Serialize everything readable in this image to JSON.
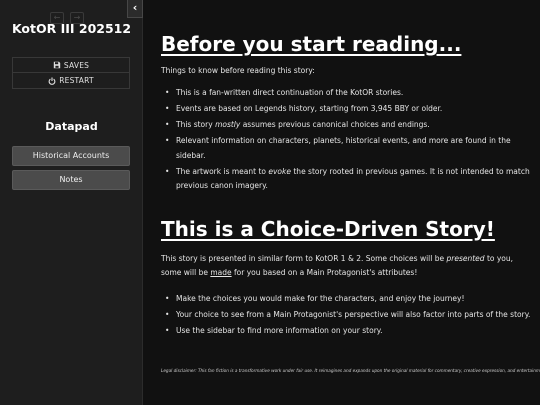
{
  "sidebar": {
    "title": "KotOR III 202512",
    "back_icon": "arrow-left-icon",
    "forward_icon": "arrow-right-icon",
    "collapse_icon": "chevron-left-icon",
    "saves_label": "SAVES",
    "restart_label": "RESTART",
    "datapad_title": "Datapad",
    "datapad_items": [
      "Historical Accounts",
      "Notes"
    ]
  },
  "main": {
    "heading_1": "Before you start reading...",
    "intro": "Things to know before reading this story:",
    "list_1": [
      {
        "text": "This is a fan-written direct continuation of the KotOR stories."
      },
      {
        "text": "Events are based on Legends history, starting from 3,945 BBY or older."
      },
      {
        "pre": "This story ",
        "em": "mostly",
        "post": " assumes previous canonical choices and endings."
      },
      {
        "text": "Relevant information on characters, planets, historical events, and more are found in the sidebar."
      },
      {
        "pre": "The artwork is meant to ",
        "em": "evoke",
        "post": " the story rooted in previous games. It is not intended to match previous canon imagery."
      }
    ],
    "heading_2": "This is a Choice-Driven Story!",
    "para_2": {
      "a": "This story is presented in similar form to KotOR 1 & 2. Some choices will be ",
      "b": "presented",
      "c": " to you, some will be ",
      "d": "made",
      "e": " for you based on a Main Protagonist's attributes!"
    },
    "list_2": [
      "Make the choices you would make for the characters, and enjoy the journey!",
      "Your choice to see from a Main Protagonist's perspective will also factor into parts of the story.",
      "Use the sidebar to find more information on your story."
    ],
    "disclaimer": "Legal disclaimer: This fan fiction is a transformative work under fair use. It reimagines and expands upon the original material for commentary, creative expression, and entertainment."
  }
}
